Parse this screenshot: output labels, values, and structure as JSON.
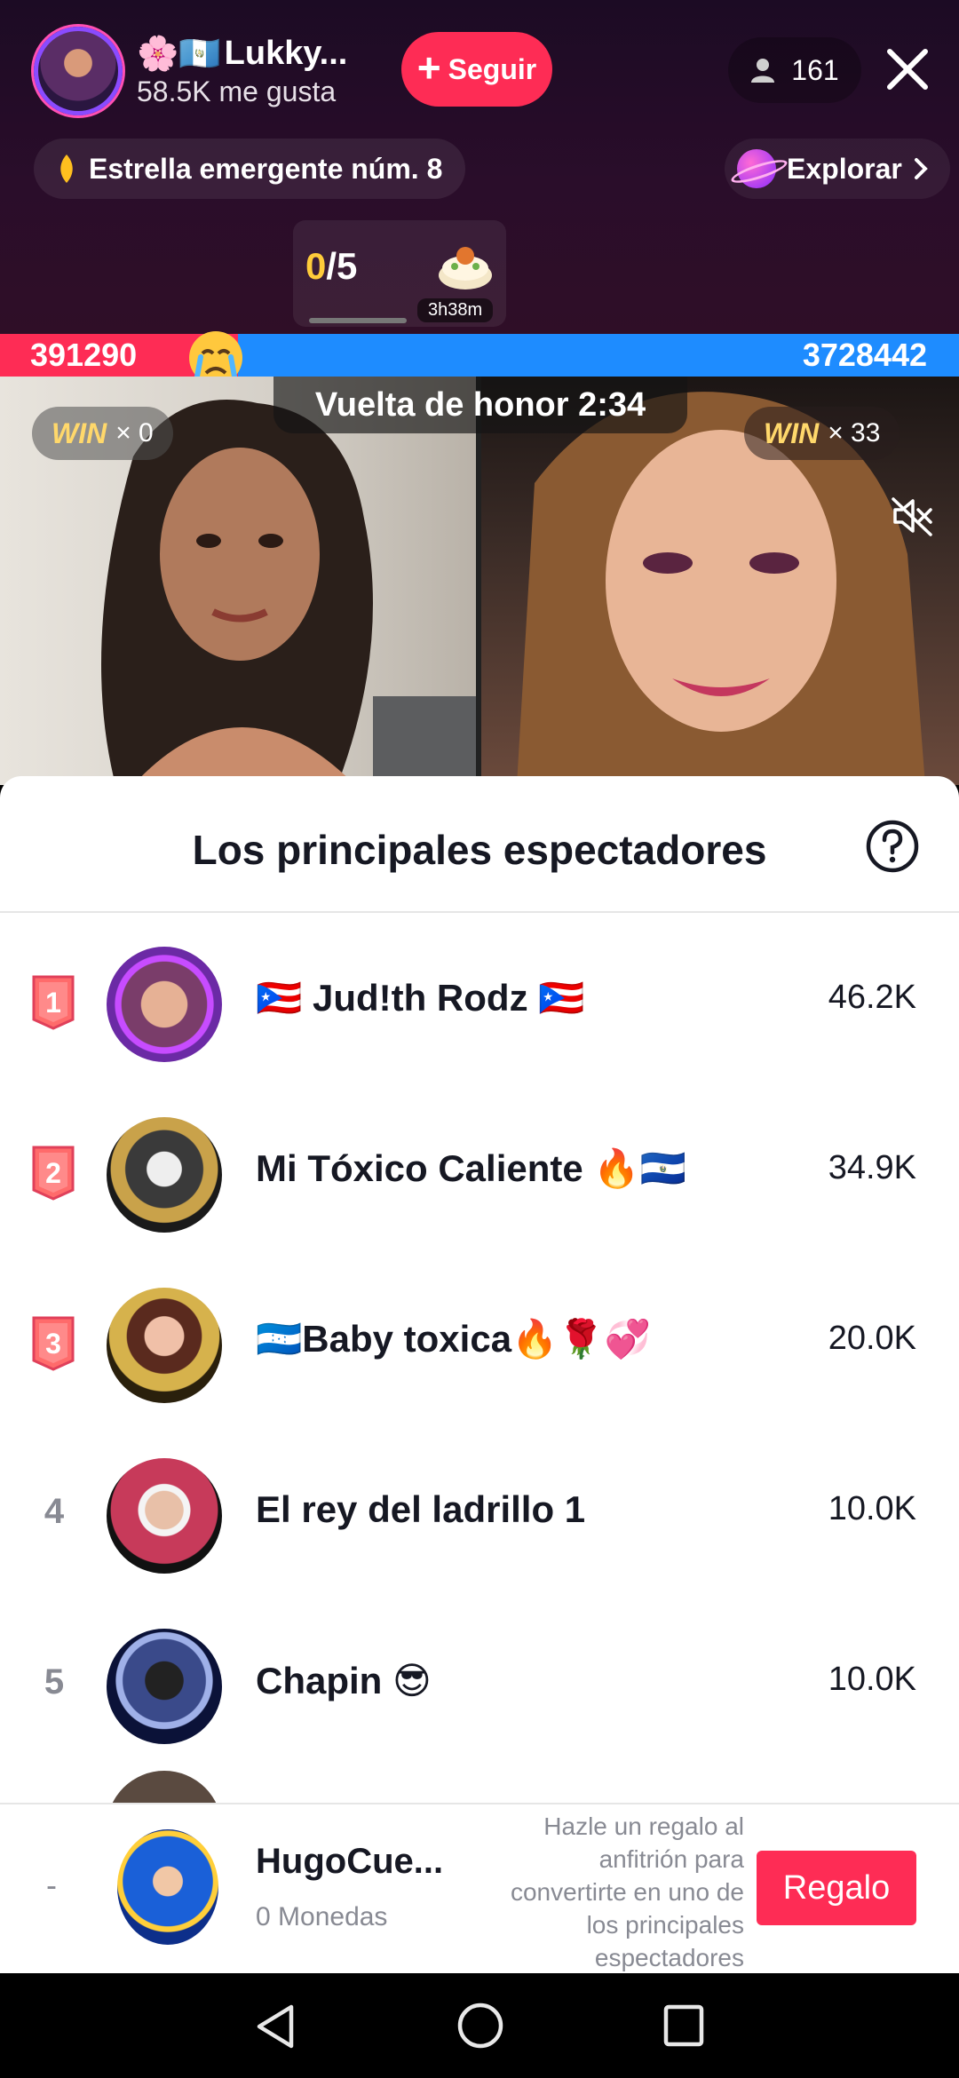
{
  "host": {
    "name": "Lukky...",
    "name_prefix_emoji": "🌸🇬🇹",
    "likes": "58.5K me gusta"
  },
  "follow_button": {
    "label": "Seguir"
  },
  "viewers": {
    "count": "161"
  },
  "star_badge": {
    "label": "Estrella emergente núm. 8"
  },
  "explore": {
    "label": "Explorar"
  },
  "goal": {
    "current": "0",
    "total": "/5",
    "timer": "3h38m"
  },
  "battle": {
    "left_score": "391290",
    "right_score": "3728442",
    "left_fraction": 0.095,
    "honor_label": "Vuelta de honor 2:34",
    "left_win_word": "WIN",
    "left_win_count": "× 0",
    "right_win_word": "WIN",
    "right_win_count": "× 33"
  },
  "sheet": {
    "title": "Los principales espectadores",
    "rows": [
      {
        "rank": "1",
        "name": "🇵🇷 Jud!th Rodz 🇵🇷",
        "score": "46.2K"
      },
      {
        "rank": "2",
        "name": "Mi Tóxico Caliente 🔥🇸🇻",
        "score": "34.9K"
      },
      {
        "rank": "3",
        "name": "🇭🇳Baby toxica🔥🌹💞",
        "score": "20.0K"
      },
      {
        "rank": "4",
        "name": "El rey del ladrillo 1",
        "score": "10.0K"
      },
      {
        "rank": "5",
        "name": "Chapin 😎",
        "score": "10.0K"
      }
    ]
  },
  "me": {
    "rank": "-",
    "name": "HugoCue...",
    "coins": "0 Monedas",
    "hint": "Hazle un regalo al anfitrión para convertirte en uno de los principales espectadores",
    "gift_label": "Regalo"
  },
  "colors": {
    "accent": "#fe2c55",
    "blue_team": "#1e8cff",
    "gold": "#ffcc3a"
  }
}
